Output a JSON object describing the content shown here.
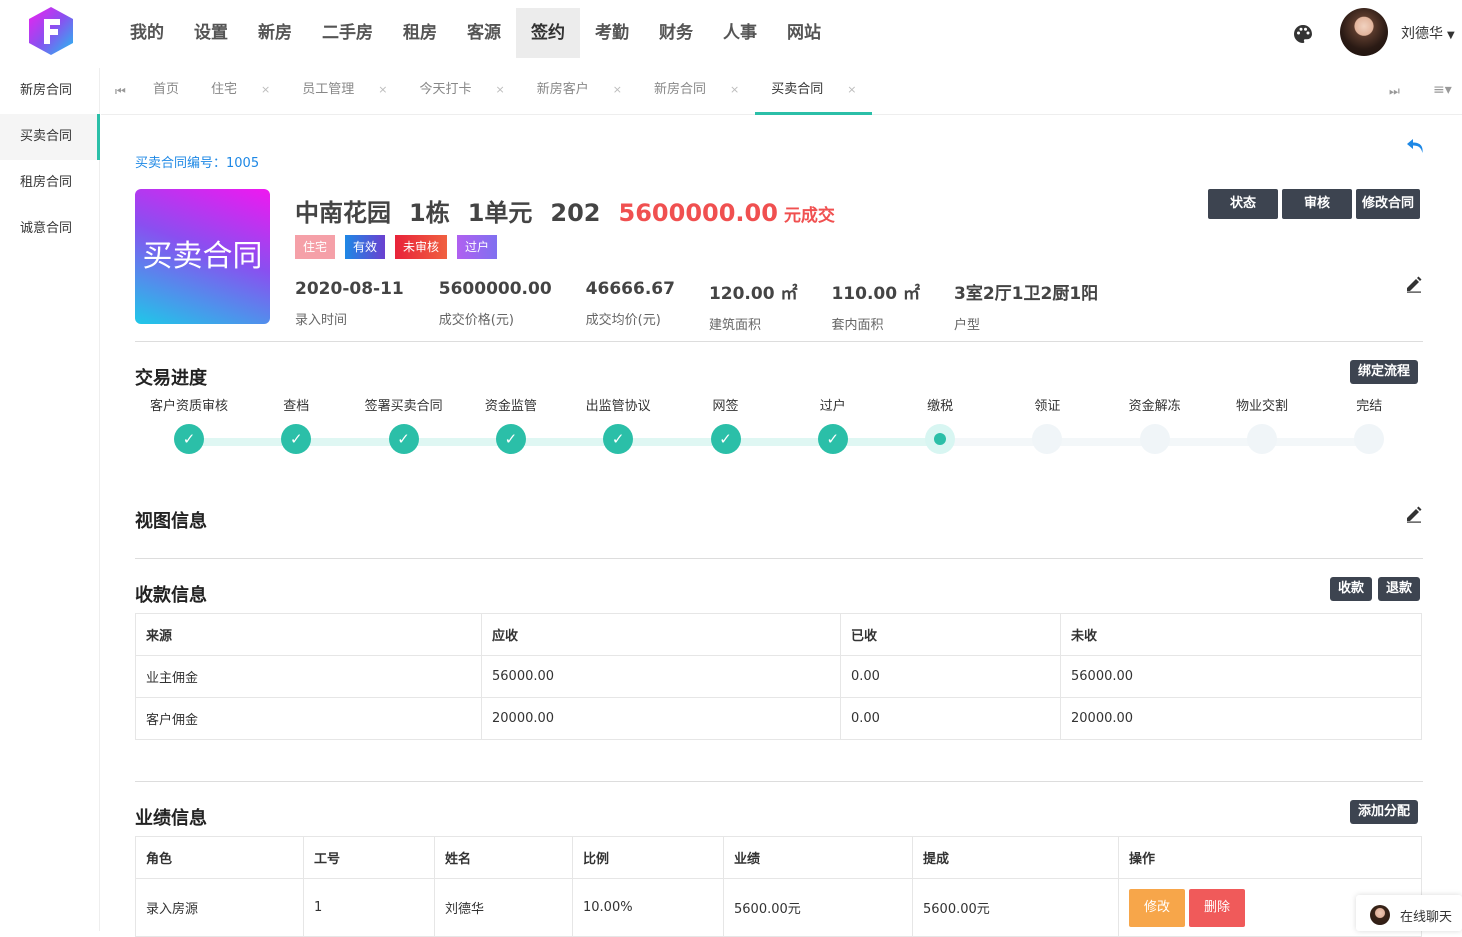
{
  "nav": {
    "items": [
      "我的",
      "设置",
      "新房",
      "二手房",
      "租房",
      "客源",
      "签约",
      "考勤",
      "财务",
      "人事",
      "网站"
    ],
    "active": "签约",
    "user": "刘德华"
  },
  "sidebar": {
    "items": [
      "新房合同",
      "买卖合同",
      "租房合同",
      "诚意合同"
    ],
    "active": "买卖合同"
  },
  "tabs": {
    "items": [
      "首页",
      "住宅",
      "员工管理",
      "今天打卡",
      "新房客户",
      "新房合同",
      "买卖合同"
    ],
    "active": "买卖合同"
  },
  "contract": {
    "number_label": "买卖合同编号：1005",
    "cover_text": "买卖合同",
    "estate": "中南花园",
    "building": "1栋",
    "unit": "1单元",
    "room": "202",
    "price": "5600000.00",
    "price_suffix": "元成交",
    "badges": [
      "住宅",
      "有效",
      "未审核",
      "过户"
    ],
    "stats": [
      {
        "value": "2020-08-11",
        "label": "录入时间"
      },
      {
        "value": "5600000.00",
        "label": "成交价格(元)"
      },
      {
        "value": "46666.67",
        "label": "成交均价(元)"
      },
      {
        "value": "120.00 ㎡",
        "label": "建筑面积"
      },
      {
        "value": "110.00 ㎡",
        "label": "套内面积"
      },
      {
        "value": "3室2厅1卫2厨1阳",
        "label": "户型"
      }
    ],
    "buttons": {
      "status": "状态",
      "review": "审核",
      "modify": "修改合同"
    }
  },
  "progress": {
    "title": "交易进度",
    "bind_button": "绑定流程",
    "steps": [
      {
        "label": "客户资质审核",
        "state": "done"
      },
      {
        "label": "查档",
        "state": "done"
      },
      {
        "label": "签署买卖合同",
        "state": "done"
      },
      {
        "label": "资金监管",
        "state": "done"
      },
      {
        "label": "出监管协议",
        "state": "done"
      },
      {
        "label": "网签",
        "state": "done"
      },
      {
        "label": "过户",
        "state": "done"
      },
      {
        "label": "缴税",
        "state": "current"
      },
      {
        "label": "领证",
        "state": "todo"
      },
      {
        "label": "资金解冻",
        "state": "todo"
      },
      {
        "label": "物业交割",
        "state": "todo"
      },
      {
        "label": "完结",
        "state": "todo"
      }
    ]
  },
  "view": {
    "title": "视图信息"
  },
  "payment": {
    "title": "收款信息",
    "collect_button": "收款",
    "refund_button": "退款",
    "columns": [
      "来源",
      "应收",
      "已收",
      "未收"
    ],
    "rows": [
      [
        "业主佣金",
        "56000.00",
        "0.00",
        "56000.00"
      ],
      [
        "客户佣金",
        "20000.00",
        "0.00",
        "20000.00"
      ]
    ]
  },
  "performance": {
    "title": "业绩信息",
    "add_button": "添加分配",
    "columns": [
      "角色",
      "工号",
      "姓名",
      "比例",
      "业绩",
      "提成",
      "操作"
    ],
    "rows": [
      [
        "录入房源",
        "1",
        "刘德华",
        "10.00%",
        "5600.00元",
        "5600.00元"
      ]
    ],
    "edit_label": "修改",
    "delete_label": "删除"
  },
  "chat": {
    "label": "在线聊天"
  },
  "colors": {
    "accent": "#2bbfa8",
    "price": "#f05050",
    "link": "#1e88e5",
    "dark_button": "#3d4450"
  }
}
